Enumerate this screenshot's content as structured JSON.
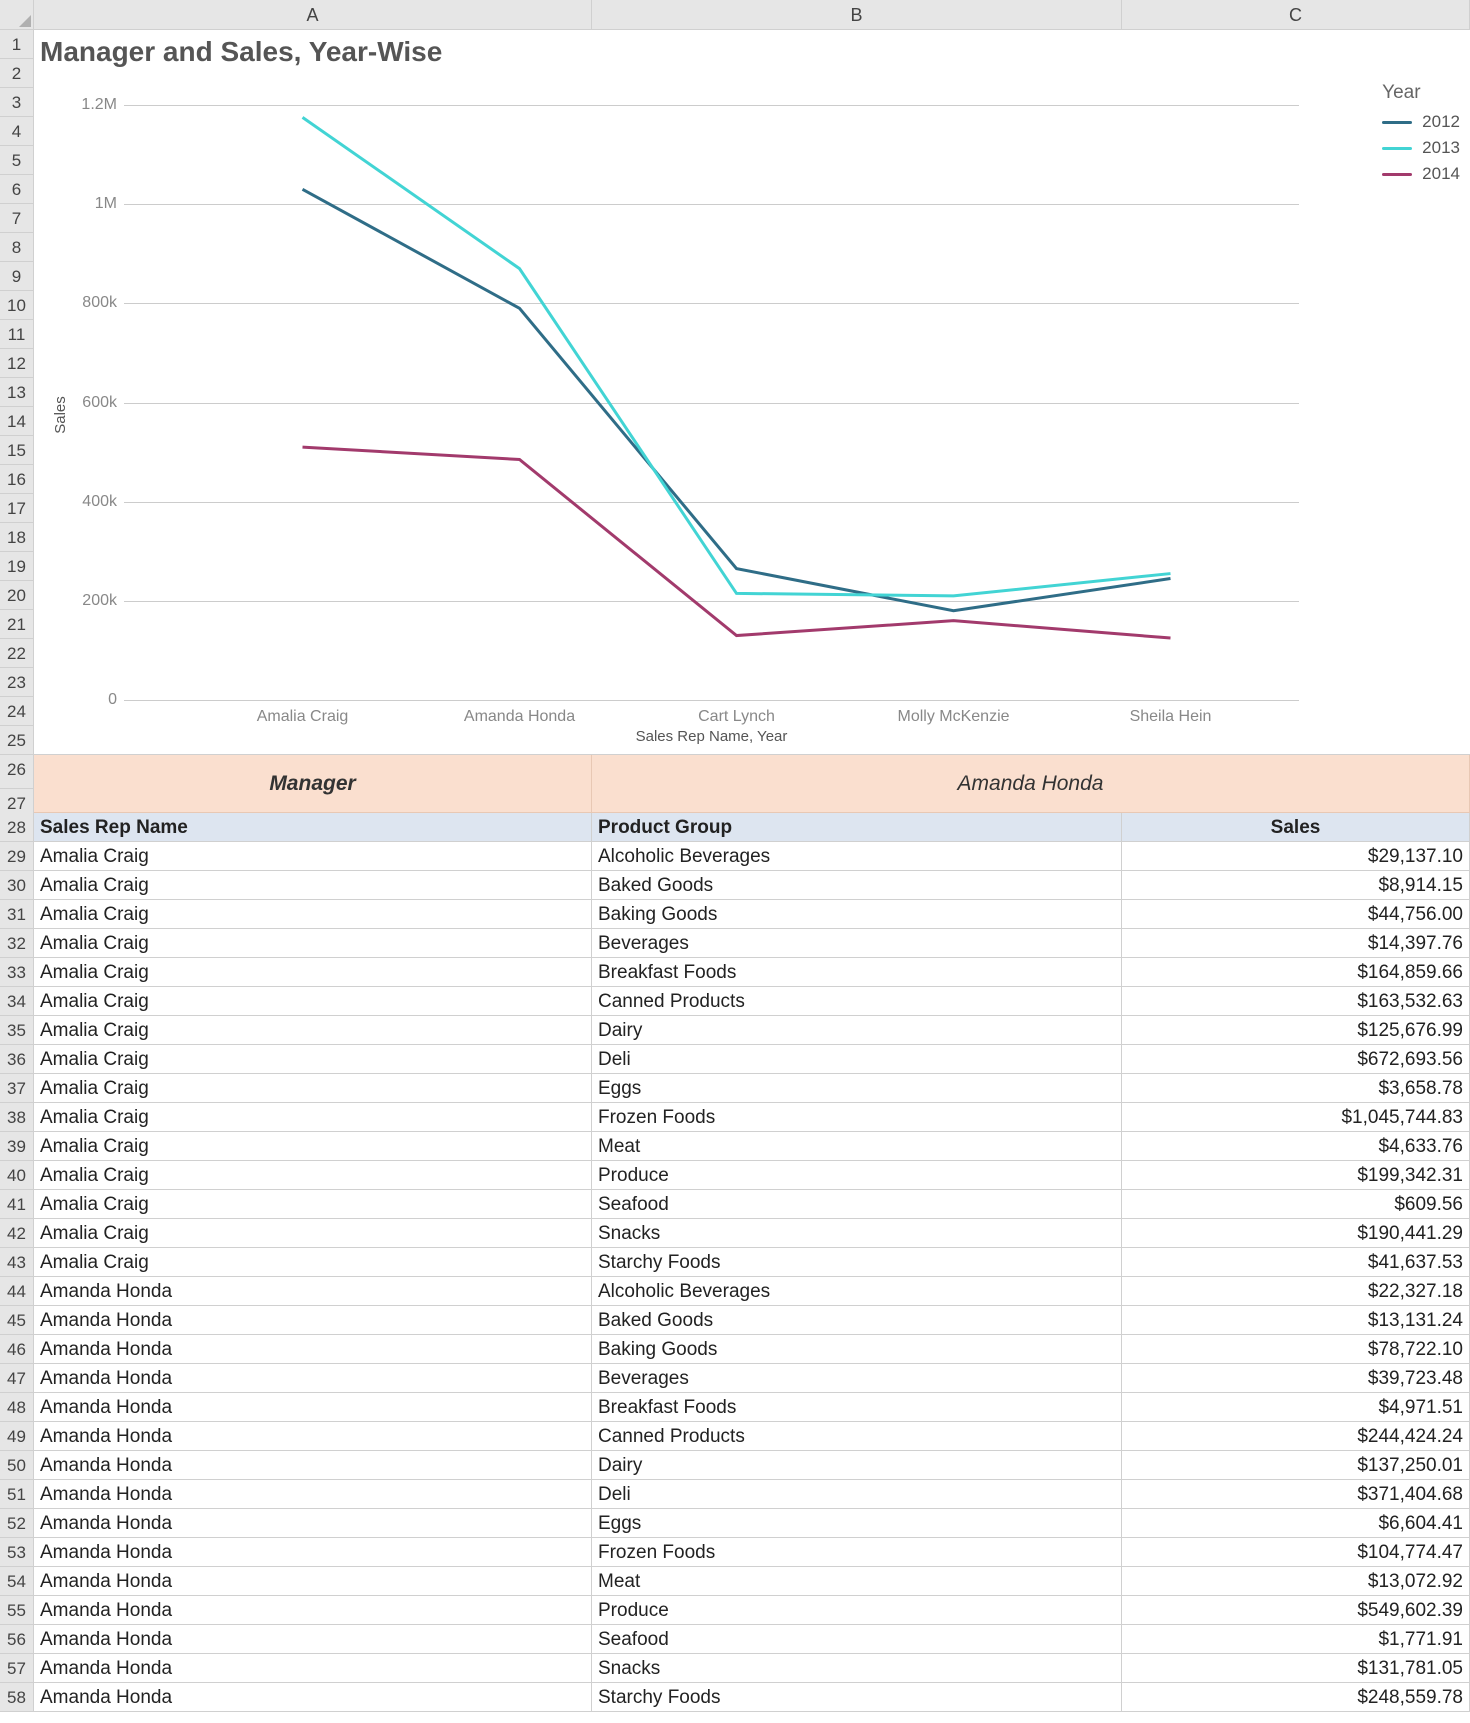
{
  "columns": [
    "A",
    "B",
    "C"
  ],
  "chart_data": {
    "type": "line",
    "title": "Manager and Sales, Year-Wise",
    "xlabel": "Sales Rep Name, Year",
    "ylabel": "Sales",
    "ylim": [
      0,
      1200000
    ],
    "yticks": [
      0,
      200000,
      400000,
      600000,
      800000,
      1000000,
      1200000
    ],
    "ytick_labels": [
      "0",
      "200k",
      "400k",
      "600k",
      "800k",
      "1M",
      "1.2M"
    ],
    "categories": [
      "Amalia Craig",
      "Amanda Honda",
      "Cart Lynch",
      "Molly McKenzie",
      "Sheila Hein"
    ],
    "legend_title": "Year",
    "series": [
      {
        "name": "2012",
        "color": "#2f6d87",
        "values": [
          1030000,
          790000,
          265000,
          180000,
          245000
        ]
      },
      {
        "name": "2013",
        "color": "#42d4d4",
        "values": [
          1175000,
          870000,
          215000,
          210000,
          255000
        ]
      },
      {
        "name": "2014",
        "color": "#a23a6c",
        "values": [
          510000,
          485000,
          130000,
          160000,
          125000
        ]
      }
    ]
  },
  "manager_bar": {
    "label": "Manager",
    "value": "Amanda Honda"
  },
  "table": {
    "headers": {
      "rep": "Sales Rep Name",
      "group": "Product Group",
      "sales": "Sales"
    },
    "rows": [
      {
        "rep": "Amalia Craig",
        "group": "Alcoholic Beverages",
        "sales": "$29,137.10"
      },
      {
        "rep": "Amalia Craig",
        "group": "Baked Goods",
        "sales": "$8,914.15"
      },
      {
        "rep": "Amalia Craig",
        "group": "Baking Goods",
        "sales": "$44,756.00"
      },
      {
        "rep": "Amalia Craig",
        "group": "Beverages",
        "sales": "$14,397.76"
      },
      {
        "rep": "Amalia Craig",
        "group": "Breakfast Foods",
        "sales": "$164,859.66"
      },
      {
        "rep": "Amalia Craig",
        "group": "Canned Products",
        "sales": "$163,532.63"
      },
      {
        "rep": "Amalia Craig",
        "group": "Dairy",
        "sales": "$125,676.99"
      },
      {
        "rep": "Amalia Craig",
        "group": "Deli",
        "sales": "$672,693.56"
      },
      {
        "rep": "Amalia Craig",
        "group": "Eggs",
        "sales": "$3,658.78"
      },
      {
        "rep": "Amalia Craig",
        "group": "Frozen Foods",
        "sales": "$1,045,744.83"
      },
      {
        "rep": "Amalia Craig",
        "group": "Meat",
        "sales": "$4,633.76"
      },
      {
        "rep": "Amalia Craig",
        "group": "Produce",
        "sales": "$199,342.31"
      },
      {
        "rep": "Amalia Craig",
        "group": "Seafood",
        "sales": "$609.56"
      },
      {
        "rep": "Amalia Craig",
        "group": "Snacks",
        "sales": "$190,441.29"
      },
      {
        "rep": "Amalia Craig",
        "group": "Starchy Foods",
        "sales": "$41,637.53"
      },
      {
        "rep": "Amanda Honda",
        "group": "Alcoholic Beverages",
        "sales": "$22,327.18"
      },
      {
        "rep": "Amanda Honda",
        "group": "Baked Goods",
        "sales": "$13,131.24"
      },
      {
        "rep": "Amanda Honda",
        "group": "Baking Goods",
        "sales": "$78,722.10"
      },
      {
        "rep": "Amanda Honda",
        "group": "Beverages",
        "sales": "$39,723.48"
      },
      {
        "rep": "Amanda Honda",
        "group": "Breakfast Foods",
        "sales": "$4,971.51"
      },
      {
        "rep": "Amanda Honda",
        "group": "Canned Products",
        "sales": "$244,424.24"
      },
      {
        "rep": "Amanda Honda",
        "group": "Dairy",
        "sales": "$137,250.01"
      },
      {
        "rep": "Amanda Honda",
        "group": "Deli",
        "sales": "$371,404.68"
      },
      {
        "rep": "Amanda Honda",
        "group": "Eggs",
        "sales": "$6,604.41"
      },
      {
        "rep": "Amanda Honda",
        "group": "Frozen Foods",
        "sales": "$104,774.47"
      },
      {
        "rep": "Amanda Honda",
        "group": "Meat",
        "sales": "$13,072.92"
      },
      {
        "rep": "Amanda Honda",
        "group": "Produce",
        "sales": "$549,602.39"
      },
      {
        "rep": "Amanda Honda",
        "group": "Seafood",
        "sales": "$1,771.91"
      },
      {
        "rep": "Amanda Honda",
        "group": "Snacks",
        "sales": "$131,781.05"
      },
      {
        "rep": "Amanda Honda",
        "group": "Starchy Foods",
        "sales": "$248,559.78"
      }
    ]
  }
}
